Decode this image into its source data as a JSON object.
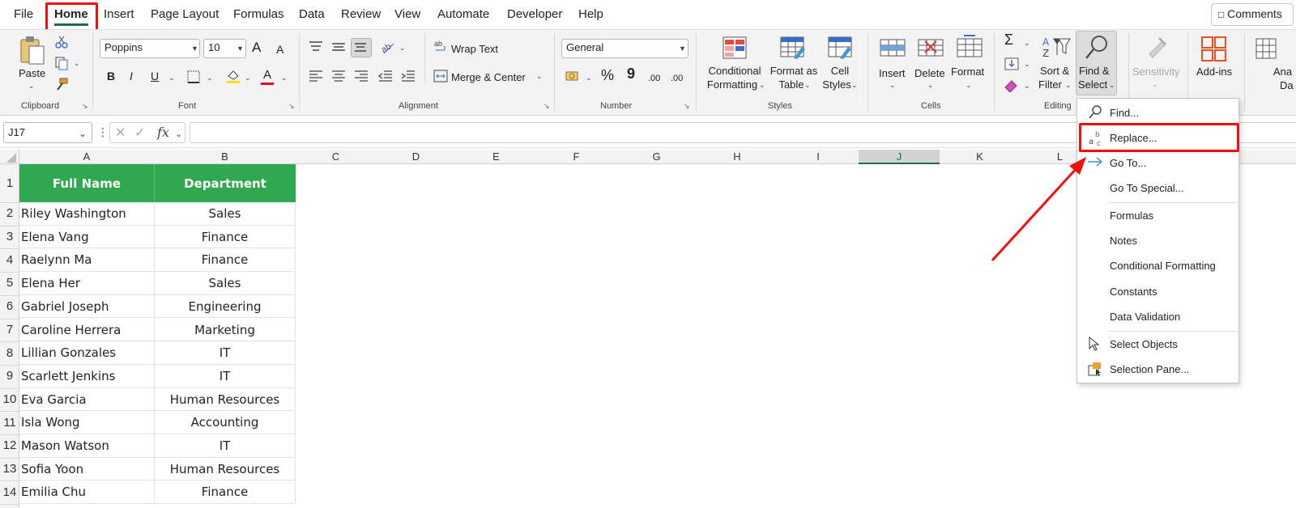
{
  "menu": {
    "tabs": [
      "File",
      "Home",
      "Insert",
      "Page Layout",
      "Formulas",
      "Data",
      "Review",
      "View",
      "Automate",
      "Developer",
      "Help"
    ],
    "comments_label": "Comments"
  },
  "ribbon": {
    "clipboard": {
      "paste": "Paste",
      "group": "Clipboard"
    },
    "font": {
      "family": "Poppins",
      "size": "10",
      "bold": "B",
      "italic": "I",
      "underline": "U",
      "grow": "A",
      "shrink": "A",
      "color_glyph": "A",
      "group": "Font"
    },
    "alignment": {
      "wrap": "Wrap Text",
      "merge": "Merge & Center",
      "group": "Alignment"
    },
    "number": {
      "format": "General",
      "percent": "%",
      "comma": "9",
      "inc_decimal": ".00",
      "dec_decimal": ".00",
      "group": "Number"
    },
    "styles": {
      "conditional": [
        "Conditional",
        "Formatting"
      ],
      "format_table": [
        "Format as",
        "Table"
      ],
      "cell_styles": [
        "Cell",
        "Styles"
      ],
      "group": "Styles"
    },
    "cells": {
      "insert": "Insert",
      "delete": "Delete",
      "format": "Format",
      "group": "Cells"
    },
    "editing": {
      "sort": [
        "Sort &",
        "Filter"
      ],
      "find": [
        "Find &",
        "Select"
      ],
      "group": "Editing"
    },
    "sensitivity": "Sensitivity",
    "addins": "Add-ins",
    "analyze": [
      "Ana",
      "Da"
    ]
  },
  "formula_bar": {
    "name_box": "J17",
    "fx": "fx"
  },
  "columns": [
    "A",
    "B",
    "C",
    "D",
    "E",
    "F",
    "G",
    "H",
    "I",
    "J",
    "K",
    "L"
  ],
  "selected_column": "J",
  "table": {
    "headers": [
      "Full Name",
      "Department"
    ],
    "rows": [
      [
        "Riley Washington",
        "Sales"
      ],
      [
        "Elena Vang",
        "Finance"
      ],
      [
        "Raelynn Ma",
        "Finance"
      ],
      [
        "Elena Her",
        "Sales"
      ],
      [
        "Gabriel Joseph",
        "Engineering"
      ],
      [
        "Caroline Herrera",
        "Marketing"
      ],
      [
        "Lillian Gonzales",
        "IT"
      ],
      [
        "Scarlett Jenkins",
        "IT"
      ],
      [
        "Eva Garcia",
        "Human Resources"
      ],
      [
        "Isla Wong",
        "Accounting"
      ],
      [
        "Mason Watson",
        "IT"
      ],
      [
        "Sofia Yoon",
        "Human Resources"
      ],
      [
        "Emilia Chu",
        "Finance"
      ]
    ],
    "row_numbers": [
      "1",
      "2",
      "3",
      "4",
      "5",
      "6",
      "7",
      "8",
      "9",
      "10",
      "11",
      "12",
      "13",
      "14"
    ]
  },
  "dropdown": {
    "items": [
      "Find...",
      "Replace...",
      "Go To...",
      "Go To Special...",
      "Formulas",
      "Notes",
      "Conditional Formatting",
      "Constants",
      "Data Validation",
      "Select Objects",
      "Selection Pane..."
    ]
  },
  "colors": {
    "accent_green": "#2fa850",
    "highlight_red": "#f01010",
    "excel_green": "#1e7145"
  }
}
